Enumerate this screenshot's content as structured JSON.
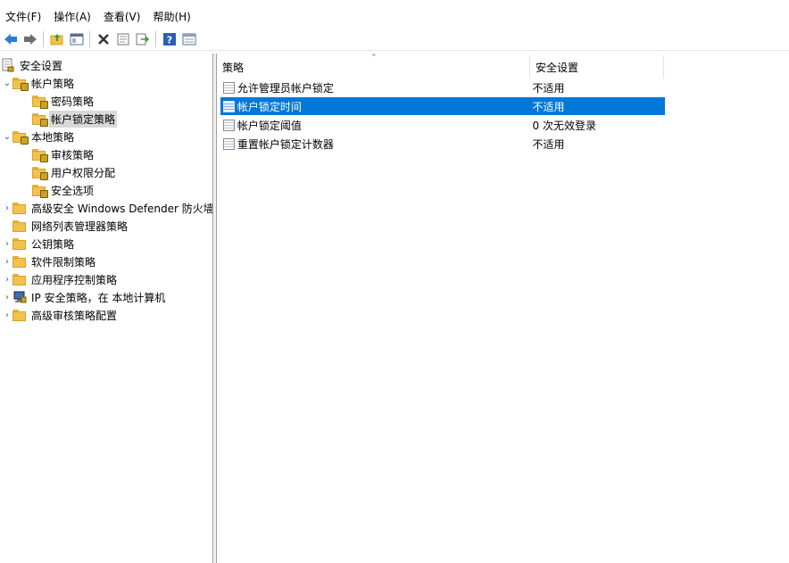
{
  "menubar": {
    "items": [
      "文件(F)",
      "操作(A)",
      "查看(V)",
      "帮助(H)"
    ]
  },
  "toolbar": {
    "buttons": [
      "back-icon",
      "forward-icon",
      "up-folder-icon",
      "show-hide-tree-icon",
      "delete-icon",
      "properties-icon",
      "export-list-icon",
      "help-icon",
      "view-icon"
    ]
  },
  "tree": {
    "root": "安全设置",
    "account_policies": "帐户策略",
    "password_policy": "密码策略",
    "account_lockout_policy": "帐户锁定策略",
    "local_policies": "本地策略",
    "audit_policy": "审核策略",
    "user_rights": "用户权限分配",
    "security_options": "安全选项",
    "defender_firewall": "高级安全 Windows Defender 防火墙",
    "network_list": "网络列表管理器策略",
    "public_key": "公钥策略",
    "software_restriction": "软件限制策略",
    "app_control": "应用程序控制策略",
    "ip_security": "IP 安全策略，在 本地计算机",
    "advanced_audit": "高级审核策略配置"
  },
  "list": {
    "col_policy": "策略",
    "col_setting": "安全设置",
    "rows": [
      {
        "name": "允许管理员帐户锁定",
        "value": "不适用"
      },
      {
        "name": "帐户锁定时间",
        "value": "不适用"
      },
      {
        "name": "帐户锁定阈值",
        "value": "0 次无效登录"
      },
      {
        "name": "重置帐户锁定计数器",
        "value": "不适用"
      }
    ]
  },
  "colors": {
    "selection": "#0078d7",
    "tree_selection": "#d9d9d9"
  }
}
